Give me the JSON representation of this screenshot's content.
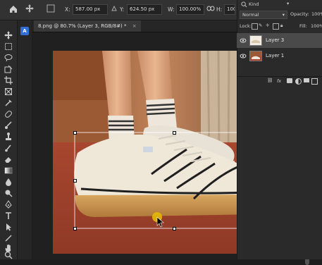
{
  "options_bar": {
    "x_label": "X:",
    "x_value": "587.00 px",
    "y_label": "Y:",
    "y_value": "624.50 px",
    "w_label": "W:",
    "w_value": "100.00%",
    "h_label": "H:",
    "h_value": "100.00%"
  },
  "document": {
    "tab_title": "8.png @ 80.7% (Layer 3, RGB/8#) *",
    "close_glyph": "×"
  },
  "layers_panel": {
    "kind_label": "Kind",
    "blend_mode": "Normal",
    "opacity_label": "Opacity:",
    "opacity_value": "100%",
    "lock_label": "Lock:",
    "fill_label": "Fill:",
    "fill_value": "100%",
    "layers": [
      {
        "name": "Layer 3",
        "selected": true
      },
      {
        "name": "Layer 1",
        "selected": false
      }
    ],
    "fx_label": "fx"
  },
  "colors": {
    "ui_dark": "#1e1e1e",
    "panel": "#2a2a2a",
    "selected_layer": "#4a4a4a",
    "accent_blue": "#2f6fd6",
    "cursor_yellow": "#e5b800"
  }
}
